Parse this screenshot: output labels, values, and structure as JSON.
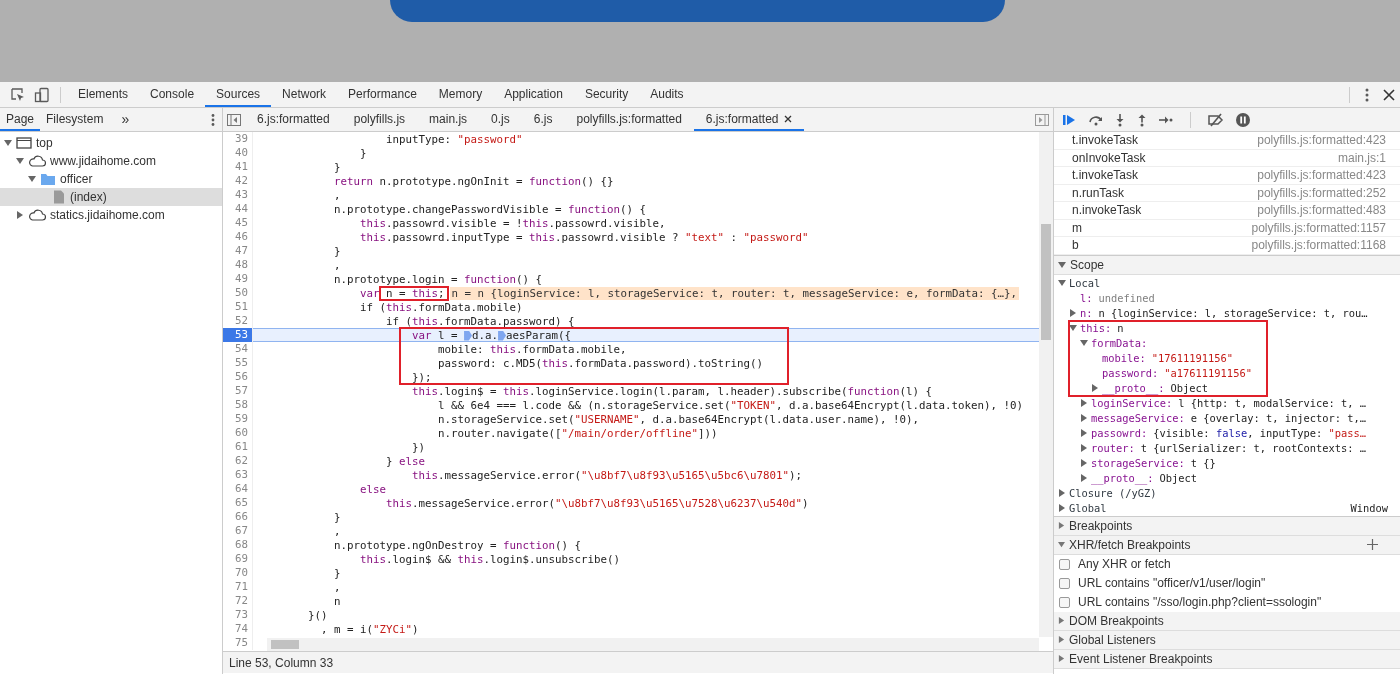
{
  "devtools": {
    "tabs": [
      {
        "label": "Elements",
        "selected": false
      },
      {
        "label": "Console",
        "selected": false
      },
      {
        "label": "Sources",
        "selected": true
      },
      {
        "label": "Network",
        "selected": false
      },
      {
        "label": "Performance",
        "selected": false
      },
      {
        "label": "Memory",
        "selected": false
      },
      {
        "label": "Application",
        "selected": false
      },
      {
        "label": "Security",
        "selected": false
      },
      {
        "label": "Audits",
        "selected": false
      }
    ]
  },
  "sources": {
    "tabs": [
      {
        "label": "Page",
        "selected": true
      },
      {
        "label": "Filesystem",
        "selected": false
      }
    ],
    "more": "»",
    "tree": [
      {
        "kind": "frame",
        "label": "top",
        "expanded": true,
        "selected": false,
        "children": [
          {
            "kind": "domain",
            "label": "www.jidaihome.com",
            "expanded": true,
            "selected": false,
            "children": [
              {
                "kind": "folder",
                "label": "officer",
                "expanded": true,
                "selected": false,
                "children": [
                  {
                    "kind": "file",
                    "label": "(index)",
                    "selected": true
                  }
                ]
              }
            ]
          },
          {
            "kind": "domain",
            "label": "statics.jidaihome.com",
            "expanded": false,
            "selected": false
          }
        ]
      }
    ]
  },
  "editor": {
    "tabs": [
      {
        "label": "6.js:formatted",
        "selected": false
      },
      {
        "label": "polyfills.js",
        "selected": false
      },
      {
        "label": "main.js",
        "selected": false
      },
      {
        "label": "0.js",
        "selected": false
      },
      {
        "label": "6.js",
        "selected": false
      },
      {
        "label": "polyfills.js:formatted",
        "selected": false
      },
      {
        "label": "6.js:formatted",
        "selected": true
      }
    ],
    "lines": [
      {
        "number": "39",
        "current": false,
        "segments": [
          {
            "kind": "plain",
            "t": "                    inputType: "
          },
          {
            "kind": "string",
            "t": "\"password\""
          }
        ]
      },
      {
        "number": "40",
        "current": false,
        "segments": [
          {
            "kind": "plain",
            "t": "                }"
          }
        ]
      },
      {
        "number": "41",
        "current": false,
        "segments": [
          {
            "kind": "plain",
            "t": "            }"
          }
        ]
      },
      {
        "number": "42",
        "current": false,
        "segments": [
          {
            "kind": "keyword",
            "t": "            return"
          },
          {
            "kind": "plain",
            "t": " n.prototype.ngOnInit = "
          },
          {
            "kind": "keyword",
            "t": "function"
          },
          {
            "kind": "plain",
            "t": "() {}"
          }
        ]
      },
      {
        "number": "43",
        "current": false,
        "segments": [
          {
            "kind": "plain",
            "t": "            ,"
          }
        ]
      },
      {
        "number": "44",
        "current": false,
        "segments": [
          {
            "kind": "plain",
            "t": "            n.prototype.changePasswordVisible = "
          },
          {
            "kind": "keyword",
            "t": "function"
          },
          {
            "kind": "plain",
            "t": "() {"
          }
        ]
      },
      {
        "number": "45",
        "current": false,
        "segments": [
          {
            "kind": "keyword",
            "t": "                this"
          },
          {
            "kind": "plain",
            "t": ".passowrd.visible = !"
          },
          {
            "kind": "keyword",
            "t": "this"
          },
          {
            "kind": "plain",
            "t": ".passowrd.visible,"
          }
        ]
      },
      {
        "number": "46",
        "current": false,
        "segments": [
          {
            "kind": "keyword",
            "t": "                this"
          },
          {
            "kind": "plain",
            "t": ".passowrd.inputType = "
          },
          {
            "kind": "keyword",
            "t": "this"
          },
          {
            "kind": "plain",
            "t": ".passowrd.visible ? "
          },
          {
            "kind": "string",
            "t": "\"text\""
          },
          {
            "kind": "plain",
            "t": " : "
          },
          {
            "kind": "string",
            "t": "\"password\""
          }
        ]
      },
      {
        "number": "47",
        "current": false,
        "segments": [
          {
            "kind": "plain",
            "t": "            }"
          }
        ]
      },
      {
        "number": "48",
        "current": false,
        "segments": [
          {
            "kind": "plain",
            "t": "            ,"
          }
        ]
      },
      {
        "number": "49",
        "current": false,
        "segments": [
          {
            "kind": "plain",
            "t": "            n.prototype.login = "
          },
          {
            "kind": "keyword",
            "t": "function"
          },
          {
            "kind": "plain",
            "t": "() {"
          }
        ]
      },
      {
        "number": "50",
        "current": false,
        "segments": [
          {
            "kind": "keyword",
            "t": "                var"
          },
          {
            "kind": "plain",
            "t": " n = "
          },
          {
            "kind": "keyword",
            "t": "this"
          },
          {
            "kind": "plain",
            "t": ";"
          }
        ],
        "preview": "n = n {loginService: l, storageService: t, router: t, messageService: e, formData: {…},"
      },
      {
        "number": "51",
        "current": false,
        "segments": [
          {
            "kind": "plain",
            "t": "                if ("
          },
          {
            "kind": "keyword",
            "t": "this"
          },
          {
            "kind": "plain",
            "t": ".formData.mobile)"
          }
        ]
      },
      {
        "number": "52",
        "current": false,
        "segments": [
          {
            "kind": "plain",
            "t": "                    if ("
          },
          {
            "kind": "keyword",
            "t": "this"
          },
          {
            "kind": "plain",
            "t": ".formData.password) {"
          }
        ]
      },
      {
        "number": "53",
        "current": true,
        "segments": [
          {
            "kind": "keyword",
            "t": "                        var"
          },
          {
            "kind": "plain",
            "t": " l = "
          },
          {
            "kind": "marker"
          },
          {
            "kind": "plain",
            "t": "d.a."
          },
          {
            "kind": "marker"
          },
          {
            "kind": "plain",
            "t": "aesParam({"
          }
        ]
      },
      {
        "number": "54",
        "current": false,
        "segments": [
          {
            "kind": "plain",
            "t": "                            mobile: "
          },
          {
            "kind": "keyword",
            "t": "this"
          },
          {
            "kind": "plain",
            "t": ".formData.mobile,"
          }
        ]
      },
      {
        "number": "55",
        "current": false,
        "segments": [
          {
            "kind": "plain",
            "t": "                            password: c.MD5("
          },
          {
            "kind": "keyword",
            "t": "this"
          },
          {
            "kind": "plain",
            "t": ".formData.password).toString()"
          }
        ]
      },
      {
        "number": "56",
        "current": false,
        "segments": [
          {
            "kind": "plain",
            "t": "                        });"
          }
        ]
      },
      {
        "number": "57",
        "current": false,
        "segments": [
          {
            "kind": "keyword",
            "t": "                        this"
          },
          {
            "kind": "plain",
            "t": ".login$ = "
          },
          {
            "kind": "keyword",
            "t": "this"
          },
          {
            "kind": "plain",
            "t": ".loginService.login(l.param, l.header).subscribe("
          },
          {
            "kind": "keyword",
            "t": "function"
          },
          {
            "kind": "plain",
            "t": "(l) {"
          }
        ]
      },
      {
        "number": "58",
        "current": false,
        "segments": [
          {
            "kind": "plain",
            "t": "                            l && 6e4 === l.code && (n.storageService.set("
          },
          {
            "kind": "string",
            "t": "\"TOKEN\""
          },
          {
            "kind": "plain",
            "t": ", d.a.base64Encrypt(l.data.token), !0)"
          }
        ]
      },
      {
        "number": "59",
        "current": false,
        "segments": [
          {
            "kind": "plain",
            "t": "                            n.storageService.set("
          },
          {
            "kind": "string",
            "t": "\"USERNAME\""
          },
          {
            "kind": "plain",
            "t": ", d.a.base64Encrypt(l.data.user.name), !0),"
          }
        ]
      },
      {
        "number": "60",
        "current": false,
        "segments": [
          {
            "kind": "plain",
            "t": "                            n.router.navigate(["
          },
          {
            "kind": "string",
            "t": "\"/main/order/offline\""
          },
          {
            "kind": "plain",
            "t": "]))"
          }
        ]
      },
      {
        "number": "61",
        "current": false,
        "segments": [
          {
            "kind": "plain",
            "t": "                        })"
          }
        ]
      },
      {
        "number": "62",
        "current": false,
        "segments": [
          {
            "kind": "plain",
            "t": "                    } "
          },
          {
            "kind": "keyword",
            "t": "else"
          }
        ]
      },
      {
        "number": "63",
        "current": false,
        "segments": [
          {
            "kind": "keyword",
            "t": "                        this"
          },
          {
            "kind": "plain",
            "t": ".messageService.error("
          },
          {
            "kind": "string",
            "t": "\"\\u8bf7\\u8f93\\u5165\\u5bc6\\u7801\""
          },
          {
            "kind": "plain",
            "t": ");"
          }
        ]
      },
      {
        "number": "64",
        "current": false,
        "segments": [
          {
            "kind": "keyword",
            "t": "                else"
          }
        ]
      },
      {
        "number": "65",
        "current": false,
        "segments": [
          {
            "kind": "keyword",
            "t": "                    this"
          },
          {
            "kind": "plain",
            "t": ".messageService.error("
          },
          {
            "kind": "string",
            "t": "\"\\u8bf7\\u8f93\\u5165\\u7528\\u6237\\u540d\""
          },
          {
            "kind": "plain",
            "t": ")"
          }
        ]
      },
      {
        "number": "66",
        "current": false,
        "segments": [
          {
            "kind": "plain",
            "t": "            }"
          }
        ]
      },
      {
        "number": "67",
        "current": false,
        "segments": [
          {
            "kind": "plain",
            "t": "            ,"
          }
        ]
      },
      {
        "number": "68",
        "current": false,
        "segments": [
          {
            "kind": "plain",
            "t": "            n.prototype.ngOnDestroy = "
          },
          {
            "kind": "keyword",
            "t": "function"
          },
          {
            "kind": "plain",
            "t": "() {"
          }
        ]
      },
      {
        "number": "69",
        "current": false,
        "segments": [
          {
            "kind": "keyword",
            "t": "                this"
          },
          {
            "kind": "plain",
            "t": ".login$ && "
          },
          {
            "kind": "keyword",
            "t": "this"
          },
          {
            "kind": "plain",
            "t": ".login$.unsubscribe()"
          }
        ]
      },
      {
        "number": "70",
        "current": false,
        "segments": [
          {
            "kind": "plain",
            "t": "            }"
          }
        ]
      },
      {
        "number": "71",
        "current": false,
        "segments": [
          {
            "kind": "plain",
            "t": "            ,"
          }
        ]
      },
      {
        "number": "72",
        "current": false,
        "segments": [
          {
            "kind": "plain",
            "t": "            n"
          }
        ]
      },
      {
        "number": "73",
        "current": false,
        "segments": [
          {
            "kind": "plain",
            "t": "        }()"
          }
        ]
      },
      {
        "number": "74",
        "current": false,
        "segments": [
          {
            "kind": "plain",
            "t": "          , m = i("
          },
          {
            "kind": "string",
            "t": "\"ZYCi\""
          },
          {
            "kind": "plain",
            "t": ")"
          }
        ]
      },
      {
        "number": "75",
        "current": false
      }
    ],
    "status": "Line 53, Column 33"
  },
  "debugger": {
    "call_stack": [
      {
        "name": "t.invokeTask",
        "location": "polyfills.js:formatted:423"
      },
      {
        "name": "onInvokeTask",
        "location": "main.js:1"
      },
      {
        "name": "t.invokeTask",
        "location": "polyfills.js:formatted:423"
      },
      {
        "name": "n.runTask",
        "location": "polyfills.js:formatted:252"
      },
      {
        "name": "n.invokeTask",
        "location": "polyfills.js:formatted:483"
      },
      {
        "name": "m",
        "location": "polyfills.js:formatted:1157"
      },
      {
        "name": "b",
        "location": "polyfills.js:formatted:1168"
      }
    ],
    "scope": {
      "title": "Scope",
      "expanded": true,
      "tree": [
        {
          "kind": "scope",
          "key": "Local",
          "expanded": true,
          "children": [
            {
              "kind": "property",
              "key": "l:",
              "value": [
                {
                  "kind": "muted",
                  "t": "undefined"
                }
              ]
            },
            {
              "kind": "property",
              "key": "n:",
              "expanded": false,
              "value": [
                {
                  "kind": "plain",
                  "t": "n {loginService: l, storageService: t, rou…"
                }
              ]
            },
            {
              "kind": "property",
              "key": "this:",
              "expanded": true,
              "value": [
                {
                  "kind": "plain",
                  "t": "n"
                }
              ],
              "children": [
                {
                  "kind": "property",
                  "key": "formData:",
                  "expanded": true,
                  "children": [
                    {
                      "kind": "property",
                      "key": "mobile:",
                      "value": [
                        {
                          "kind": "string",
                          "t": "\"17611191156\""
                        }
                      ]
                    },
                    {
                      "kind": "property",
                      "key": "password:",
                      "value": [
                        {
                          "kind": "string",
                          "t": "\"a17611191156\""
                        }
                      ]
                    },
                    {
                      "kind": "property",
                      "key": "__proto__:",
                      "expanded": false,
                      "value": [
                        {
                          "kind": "plain",
                          "t": "Object"
                        }
                      ]
                    }
                  ]
                },
                {
                  "kind": "property",
                  "key": "loginService:",
                  "expanded": false,
                  "value": [
                    {
                      "kind": "plain",
                      "t": "l {http: t, modalService: t, …"
                    }
                  ]
                },
                {
                  "kind": "property",
                  "key": "messageService:",
                  "expanded": false,
                  "value": [
                    {
                      "kind": "plain",
                      "t": "e {overlay: t, injector: t,…"
                    }
                  ]
                },
                {
                  "kind": "property",
                  "key": "passowrd:",
                  "expanded": false,
                  "value": [
                    {
                      "kind": "plain",
                      "t": "{visible: "
                    },
                    {
                      "kind": "number",
                      "t": "false"
                    },
                    {
                      "kind": "plain",
                      "t": ", inputType: "
                    },
                    {
                      "kind": "string",
                      "t": "\"pass…"
                    }
                  ]
                },
                {
                  "kind": "property",
                  "key": "router:",
                  "expanded": false,
                  "value": [
                    {
                      "kind": "plain",
                      "t": "t {urlSerializer: t, rootContexts: …"
                    }
                  ]
                },
                {
                  "kind": "property",
                  "key": "storageService:",
                  "expanded": false,
                  "value": [
                    {
                      "kind": "plain",
                      "t": "t {}"
                    }
                  ]
                },
                {
                  "kind": "property",
                  "key": "__proto__:",
                  "expanded": false,
                  "value": [
                    {
                      "kind": "plain",
                      "t": "Object"
                    }
                  ]
                }
              ]
            }
          ]
        },
        {
          "kind": "scope",
          "key": "Closure (/yGZ)",
          "expanded": false
        },
        {
          "kind": "scope",
          "key": "Global",
          "expanded": false,
          "right": "Window"
        }
      ]
    },
    "panes": [
      {
        "title": "Breakpoints",
        "expanded": false
      },
      {
        "title": "XHR/fetch Breakpoints",
        "expanded": true,
        "items": [
          {
            "label": "Any XHR or fetch",
            "checked": false
          },
          {
            "label": "URL contains \"officer/v1/user/login\"",
            "checked": false
          },
          {
            "label": "URL contains \"/sso/login.php?client=ssologin\"",
            "checked": false
          }
        ]
      },
      {
        "title": "DOM Breakpoints",
        "expanded": false
      },
      {
        "title": "Global Listeners",
        "expanded": false
      },
      {
        "title": "Event Listener Breakpoints",
        "expanded": false
      }
    ]
  }
}
